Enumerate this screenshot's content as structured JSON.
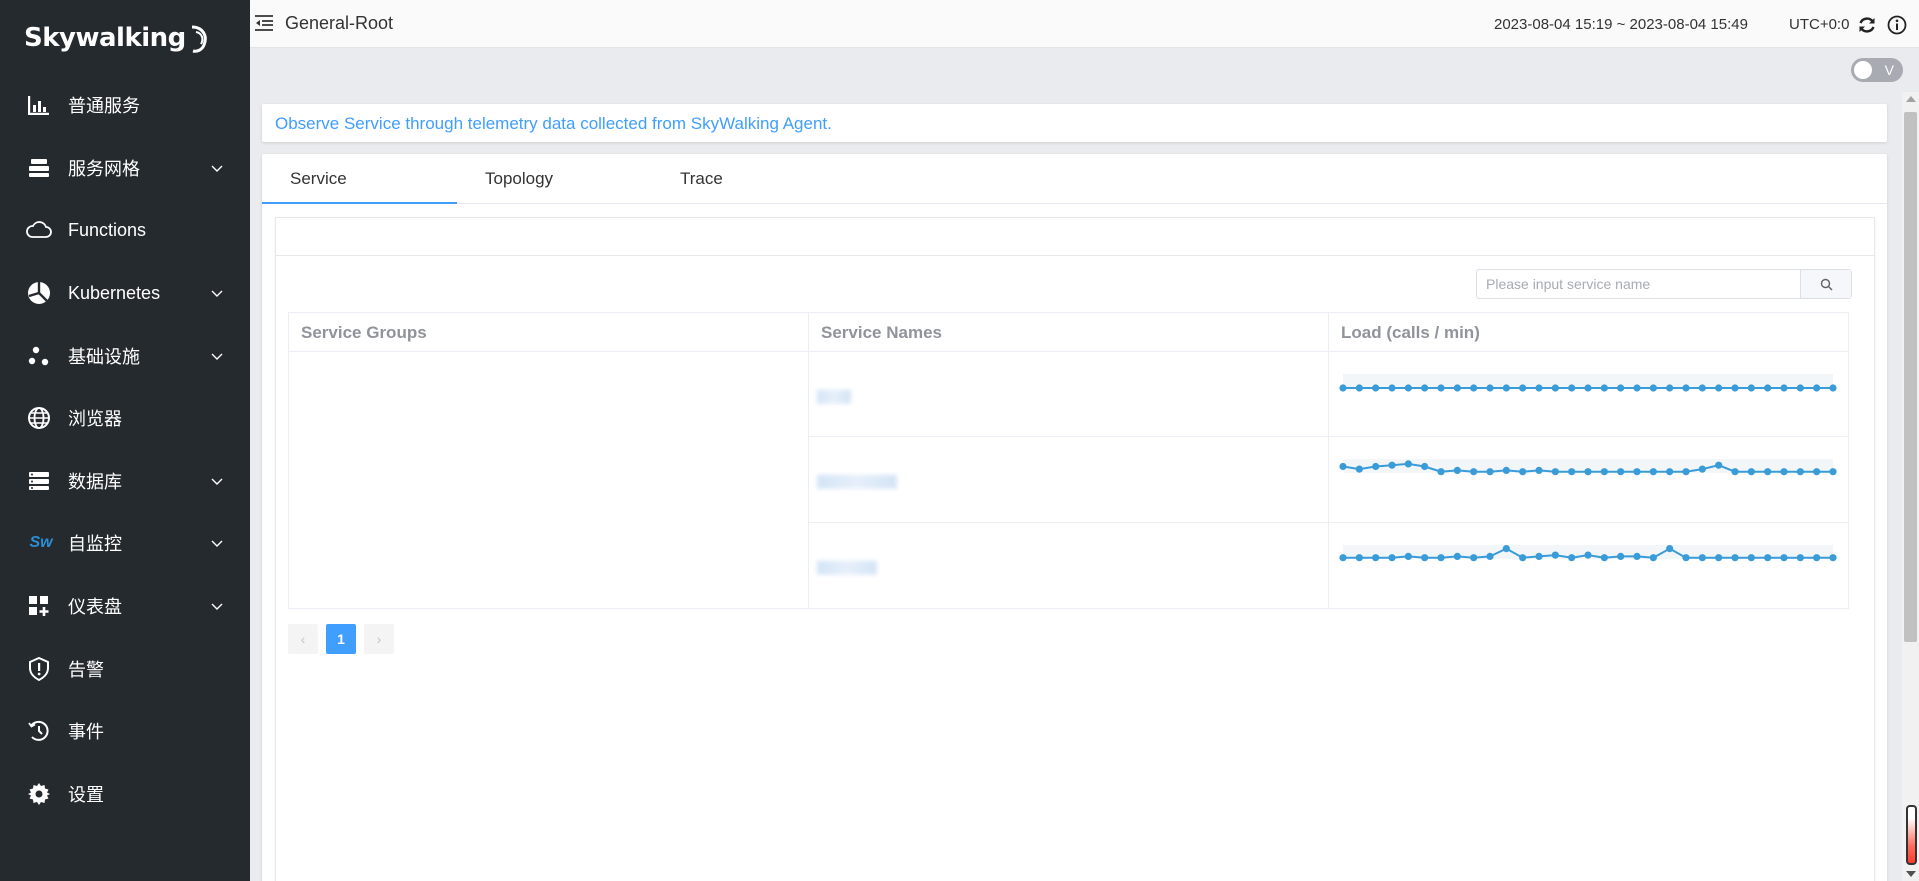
{
  "app": {
    "logo_text": "Skywalking"
  },
  "sidebar": {
    "items": [
      {
        "label": "普通服务",
        "icon": "chart-bar-icon",
        "has_children": false
      },
      {
        "label": "服务网格",
        "icon": "mesh-layers-icon",
        "has_children": true
      },
      {
        "label": "Functions",
        "icon": "cloud-icon",
        "has_children": false
      },
      {
        "label": "Kubernetes",
        "icon": "kubernetes-icon",
        "has_children": true
      },
      {
        "label": "基础设施",
        "icon": "infrastructure-nodes-icon",
        "has_children": true
      },
      {
        "label": "浏览器",
        "icon": "globe-icon",
        "has_children": false
      },
      {
        "label": "数据库",
        "icon": "database-icon",
        "has_children": true
      },
      {
        "label": "自监控",
        "icon": "sw-self-observability-icon",
        "icon_text": "Sw",
        "has_children": true
      },
      {
        "label": "仪表盘",
        "icon": "dashboard-icon",
        "has_children": true
      },
      {
        "label": "告警",
        "icon": "alert-shield-icon",
        "has_children": false
      },
      {
        "label": "事件",
        "icon": "event-clock-icon",
        "has_children": false
      },
      {
        "label": "设置",
        "icon": "gear-icon",
        "has_children": false
      }
    ]
  },
  "header": {
    "title": "General-Root",
    "time_range": "2023-08-04 15:19 ~ 2023-08-04 15:49",
    "timezone": "UTC+0:0"
  },
  "toolbar": {
    "switch_text": "V",
    "switch_on": false
  },
  "banner": {
    "text": "Observe Service through telemetry data collected from SkyWalking Agent."
  },
  "tabs": [
    {
      "label": "Service",
      "active": true
    },
    {
      "label": "Topology",
      "active": false
    },
    {
      "label": "Trace",
      "active": false
    }
  ],
  "search": {
    "placeholder": "Please input service name",
    "value": ""
  },
  "table": {
    "headers": [
      "Service Groups",
      "Service Names",
      "Load (calls / min)"
    ],
    "rows": [
      {
        "service_name_redacted": true,
        "load": [
          0,
          0,
          0,
          0,
          0,
          0,
          0,
          0,
          0,
          0,
          0,
          0,
          0,
          0,
          0,
          0,
          0,
          0,
          0,
          0,
          0,
          0,
          0,
          0,
          0,
          0,
          0,
          0,
          0,
          0,
          0
        ]
      },
      {
        "service_name_redacted": true,
        "load": [
          5,
          3,
          5,
          6,
          7,
          5,
          1,
          2,
          1,
          1,
          2,
          1,
          2,
          1,
          1,
          1,
          1,
          1,
          1,
          1,
          1,
          1,
          3,
          6,
          1,
          1,
          1,
          1,
          1,
          1,
          1
        ]
      },
      {
        "service_name_redacted": true,
        "load": [
          1,
          1,
          1,
          1,
          2,
          1,
          1,
          2,
          1,
          2,
          8,
          1,
          2,
          3,
          1,
          3,
          1,
          2,
          2,
          1,
          8,
          1,
          1,
          1,
          1,
          1,
          1,
          1,
          1,
          1,
          1
        ]
      }
    ]
  },
  "pagination": {
    "current_page": "1",
    "prev_label": "‹",
    "next_label": "›"
  },
  "colors": {
    "accent": "#409eff",
    "sidebar_bg": "#252a2f",
    "sparkline": "#3a9bd9"
  }
}
